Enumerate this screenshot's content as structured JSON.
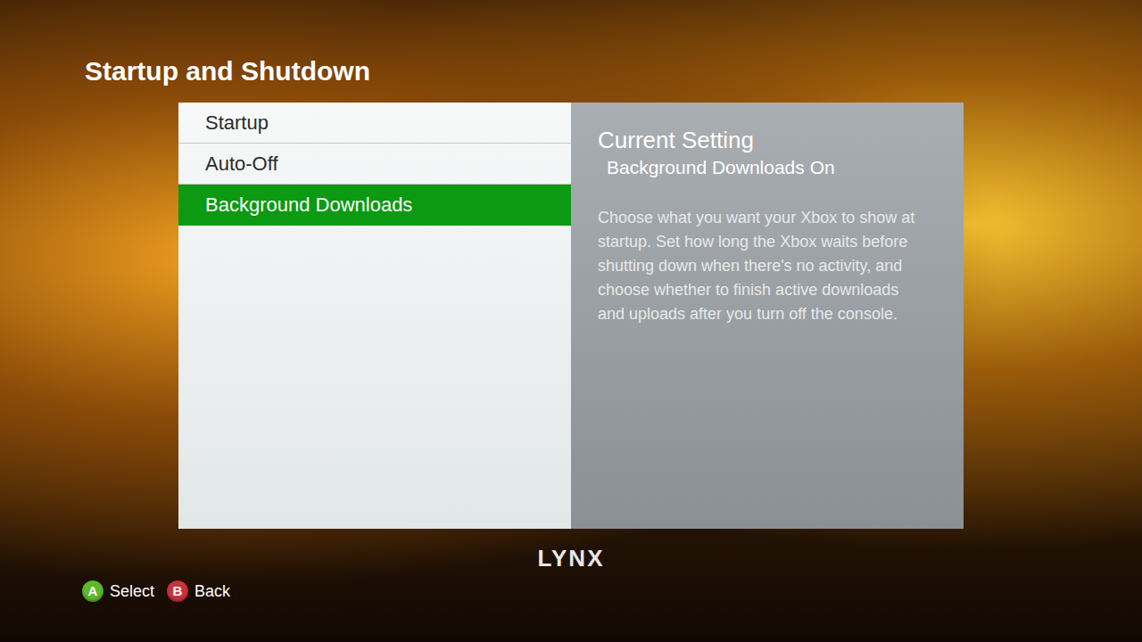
{
  "screen": {
    "title": "Startup and Shutdown"
  },
  "menu": [
    {
      "label": "Startup",
      "selected": false
    },
    {
      "label": "Auto-Off",
      "selected": false
    },
    {
      "label": "Background Downloads",
      "selected": true
    }
  ],
  "details": {
    "heading": "Current Setting",
    "value": "Background Downloads On",
    "description": "Choose what you want your Xbox to show at startup. Set how long the Xbox waits before shutting down when there's no activity, and choose whether to finish active downloads and uploads after you turn off the console."
  },
  "brand": "LYNX",
  "buttons": [
    {
      "key": "A",
      "label": "Select",
      "color": "#5db82c"
    },
    {
      "key": "B",
      "label": "Back",
      "color": "#c8323c"
    }
  ]
}
